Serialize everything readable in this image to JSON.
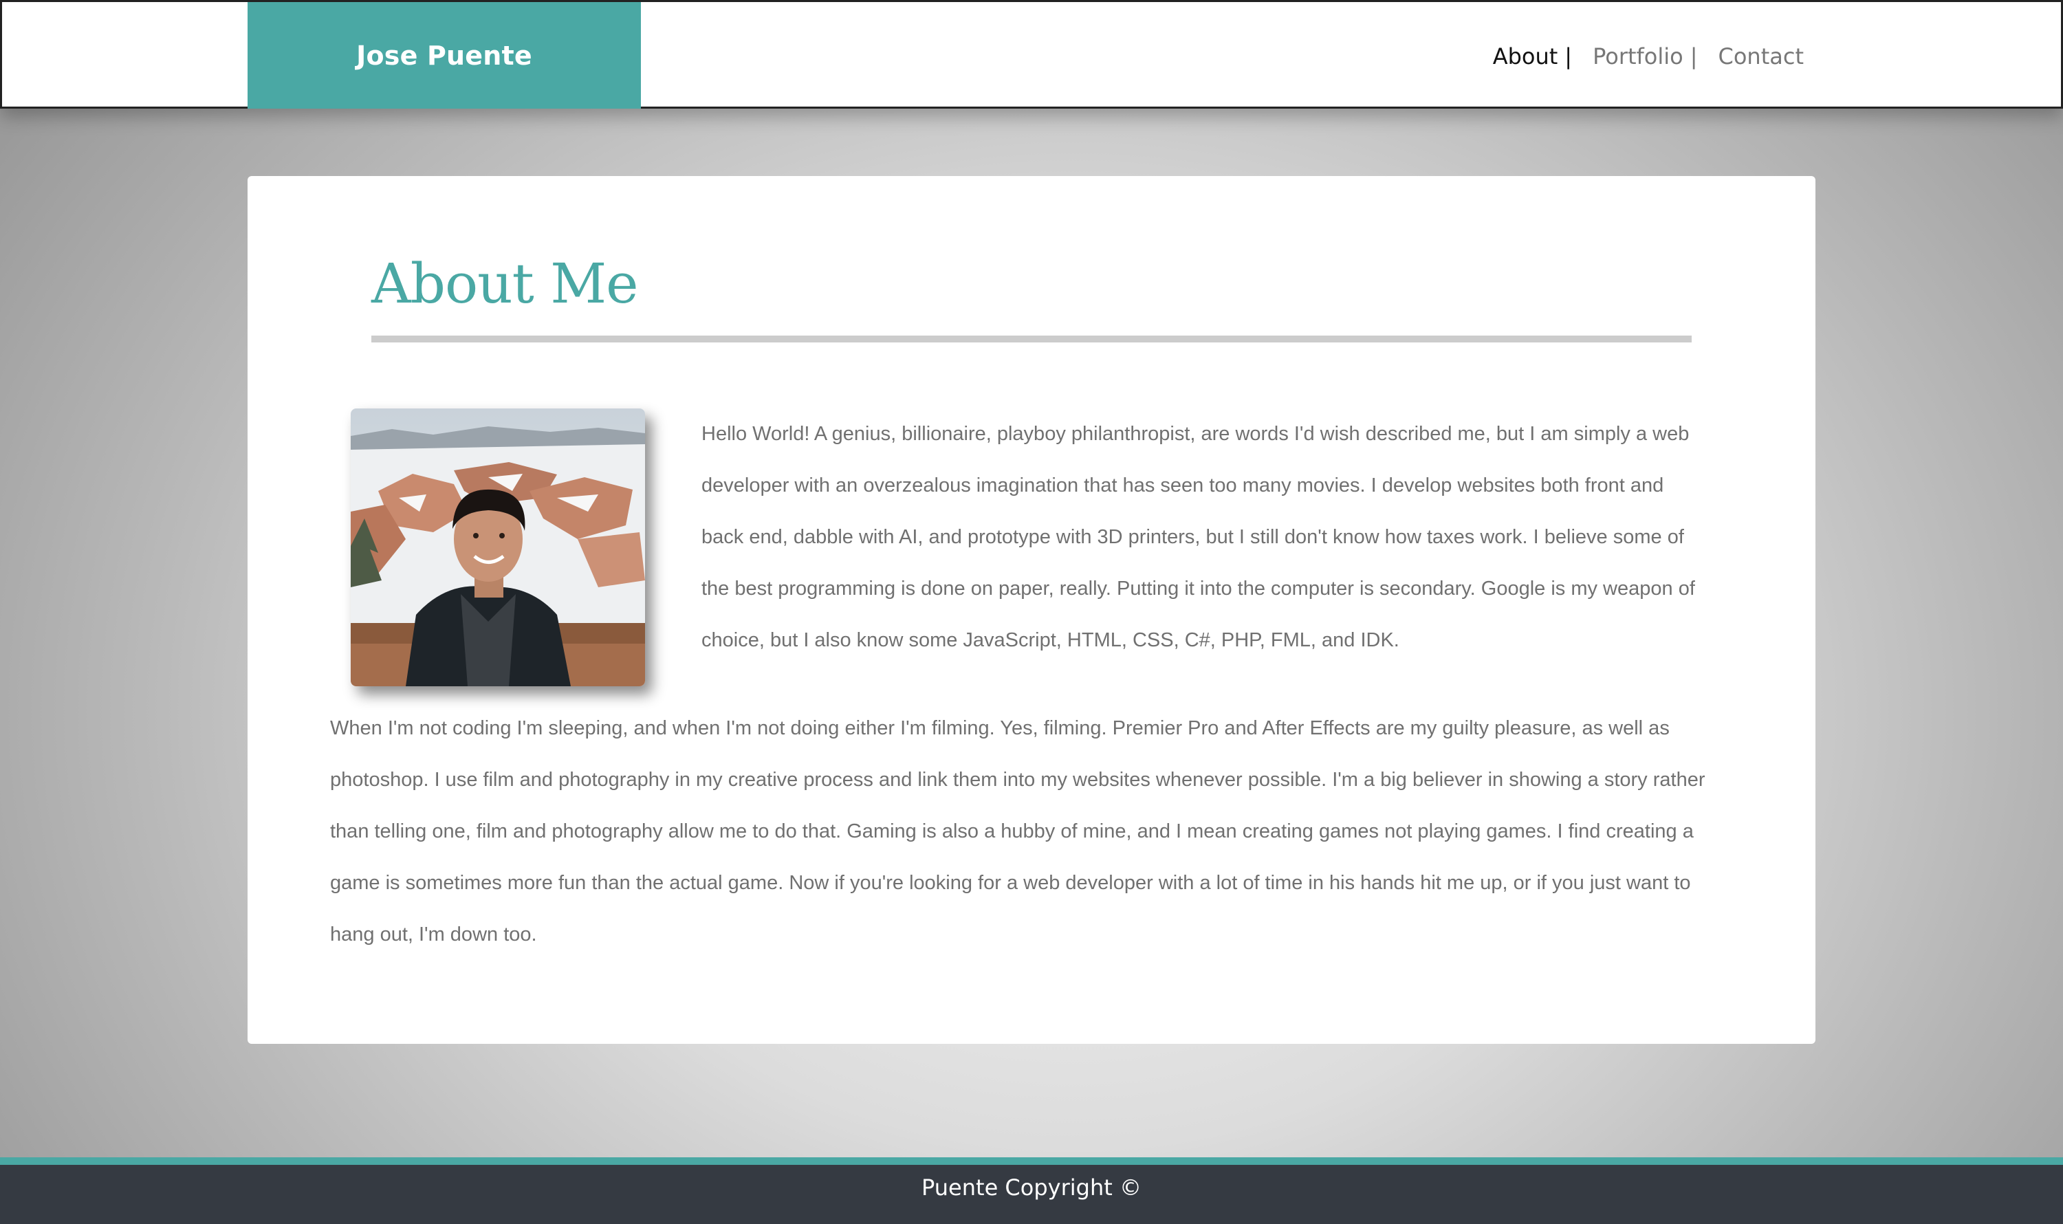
{
  "header": {
    "brand": "Jose Puente",
    "nav": [
      {
        "label": "About",
        "separator": "|"
      },
      {
        "label": "Portfolio",
        "separator": "|"
      },
      {
        "label": "Contact"
      }
    ]
  },
  "about": {
    "title": "About Me",
    "paragraph_1": "Hello World! A genius, billionaire, playboy philanthropist, are words I'd wish described me, but I am simply a web developer with an overzealous imagination that has seen too many movies. I develop websites both front and back end, dabble with AI, and prototype with 3D printers, but I still don't know how taxes work. I believe some of the best programming is done on paper, really. Putting it into the computer is secondary. Google is my weapon of choice, but I also know some JavaScript, HTML, CSS, C#, PHP, FML, and IDK.",
    "paragraph_2": "When I'm not coding I'm sleeping, and when I'm not doing either I'm filming. Yes, filming. Premier Pro and After Effects are my guilty pleasure, as well as photoshop. I use film and photography in my creative process and link them into my websites whenever possible. I'm a big believer in showing a story rather than telling one, film and photography allow me to do that. Gaming is also a hubby of mine, and I mean creating games not playing games. I find creating a game is sometimes more fun than the actual game. Now if you're looking for a web developer with a lot of time in his hands hit me up, or if you just want to hang out, I'm down too."
  },
  "footer": {
    "text": "Puente Copyright ©"
  },
  "colors": {
    "accent": "#4aa8a4",
    "footer_bg": "#353a42",
    "body_text": "#707070"
  }
}
